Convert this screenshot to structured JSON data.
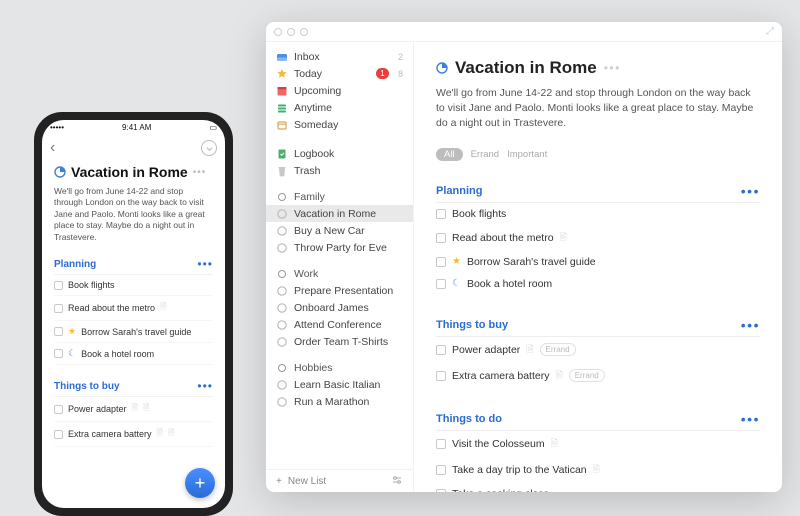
{
  "project": {
    "title": "Vacation in Rome",
    "description": "We'll go from June 14-22 and stop through London on the way back to visit Jane and Paolo. Monti looks like a great place to stay. Maybe do a night out in Trastevere."
  },
  "phone": {
    "status_time": "9:41 AM",
    "sections": [
      {
        "title": "Planning",
        "tasks": [
          {
            "label": "Book flights"
          },
          {
            "label": "Read about the metro",
            "note": true
          },
          {
            "label": "Borrow Sarah's travel guide",
            "star": true
          },
          {
            "label": "Book a hotel room",
            "moon": true
          }
        ]
      },
      {
        "title": "Things to buy",
        "tasks": [
          {
            "label": "Power adapter",
            "note": true,
            "note2": true
          },
          {
            "label": "Extra camera battery",
            "note": true,
            "note2": true
          }
        ]
      }
    ]
  },
  "sidebar": {
    "top": [
      {
        "icon": "inbox",
        "label": "Inbox",
        "count": "2"
      },
      {
        "icon": "star",
        "label": "Today",
        "badge": "1",
        "count2": "8"
      },
      {
        "icon": "calendar",
        "label": "Upcoming"
      },
      {
        "icon": "stack",
        "label": "Anytime"
      },
      {
        "icon": "box",
        "label": "Someday"
      }
    ],
    "mid": [
      {
        "icon": "logbook",
        "label": "Logbook"
      },
      {
        "icon": "trash",
        "label": "Trash"
      }
    ],
    "areas": [
      {
        "label": "Family",
        "items": [
          {
            "label": "Vacation in Rome",
            "selected": true
          },
          {
            "label": "Buy a New Car"
          },
          {
            "label": "Throw Party for Eve"
          }
        ]
      },
      {
        "label": "Work",
        "items": [
          {
            "label": "Prepare Presentation"
          },
          {
            "label": "Onboard James"
          },
          {
            "label": "Attend Conference"
          },
          {
            "label": "Order Team T-Shirts"
          }
        ]
      },
      {
        "label": "Hobbies",
        "items": [
          {
            "label": "Learn Basic Italian"
          },
          {
            "label": "Run a Marathon"
          }
        ]
      }
    ],
    "footer": {
      "add": "+",
      "label": "New List"
    }
  },
  "main": {
    "filters": [
      {
        "label": "All",
        "active": true
      },
      {
        "label": "Errand"
      },
      {
        "label": "Important"
      }
    ],
    "sections": [
      {
        "title": "Planning",
        "tasks": [
          {
            "label": "Book flights"
          },
          {
            "label": "Read about the metro",
            "note": true
          },
          {
            "label": "Borrow Sarah's travel guide",
            "star": true
          },
          {
            "label": "Book a hotel room",
            "moon": true
          }
        ]
      },
      {
        "title": "Things to buy",
        "tasks": [
          {
            "label": "Power adapter",
            "note": true,
            "tag": "Errand"
          },
          {
            "label": "Extra camera battery",
            "note": true,
            "tag": "Errand"
          }
        ]
      },
      {
        "title": "Things to do",
        "tasks": [
          {
            "label": "Visit the Colosseum",
            "note": true
          },
          {
            "label": "Take a day trip to the Vatican",
            "note": true
          },
          {
            "label": "Take a cooking class"
          }
        ]
      }
    ]
  }
}
